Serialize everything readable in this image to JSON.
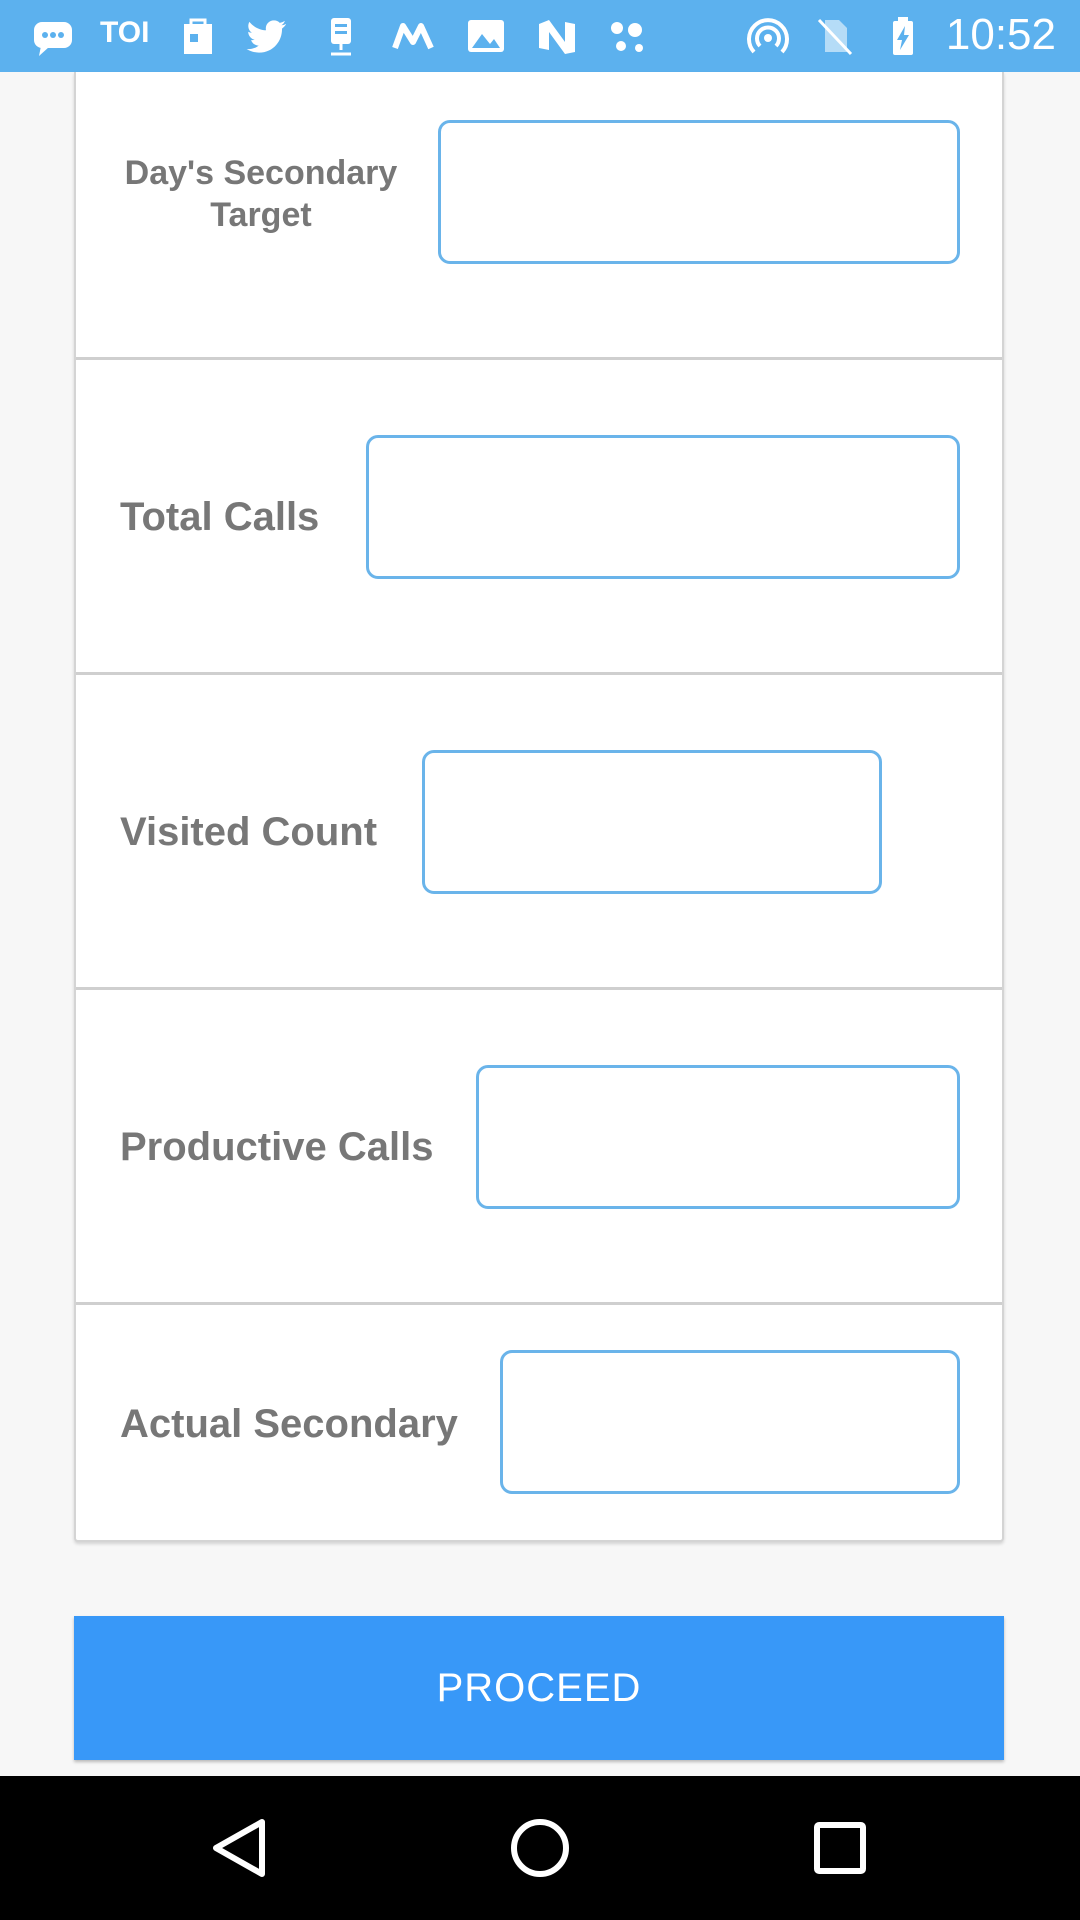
{
  "status_bar": {
    "clock": "10:52",
    "toi_text": "TOI",
    "left_icons": [
      "message-icon",
      "toi-icon",
      "shopping-icon",
      "twitter-icon",
      "cargo-icon",
      "m-app-icon",
      "image-icon",
      "n-app-icon",
      "dots-app-icon"
    ],
    "right_icons": [
      "hotspot-icon",
      "no-sim-icon",
      "battery-charging-icon"
    ]
  },
  "form": {
    "rows": [
      {
        "label": "Day's Secondary Target",
        "label_line1": "Day's Secondary",
        "label_line2": "Target",
        "value": ""
      },
      {
        "label": "Total Calls",
        "value": ""
      },
      {
        "label": "Visited Count",
        "value": ""
      },
      {
        "label": "Productive Calls",
        "value": ""
      },
      {
        "label": "Actual Secondary",
        "value": ""
      }
    ]
  },
  "proceed_button": {
    "label": "PROCEED"
  },
  "navigation_bar": {
    "buttons": [
      "back-icon",
      "home-icon",
      "recents-icon"
    ]
  },
  "colors": {
    "status_bar": "#5cb1ee",
    "field_border": "#6ab4ea",
    "button": "#3898f8",
    "label": "#777777"
  }
}
